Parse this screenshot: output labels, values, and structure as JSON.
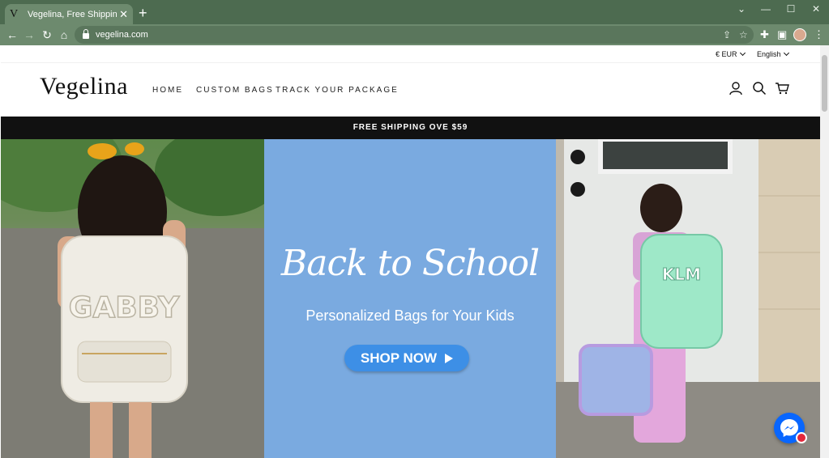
{
  "browser": {
    "tab_title": "Vegelina, Free Shipping ,Keep Mo",
    "tab_favicon_letter": "V",
    "url": "vegelina.com",
    "theme_colors": {
      "titlebar": "#4d6b50",
      "toolbar": "#6d8a6e"
    }
  },
  "site": {
    "currency": "€ EUR",
    "language": "English",
    "logo": "Vegelina",
    "nav": [
      "HOME",
      "CUSTOM BAGS",
      "TRACK YOUR PACKAGE"
    ],
    "announcement": "FREE SHIPPING OVE $59"
  },
  "hero": {
    "title": "Back to School",
    "subtitle": "Personalized Bags for Your Kids",
    "cta": "SHOP NOW",
    "left_bag_text": "GABBY",
    "right_bag_text": "KLM",
    "accent_blue": "#7aaae0",
    "button_blue": "#3d8fe6"
  },
  "icons": [
    "back-icon",
    "forward-icon",
    "reload-icon",
    "home-icon",
    "lock-icon",
    "share-icon",
    "star-icon",
    "extensions-icon",
    "sidepanel-icon",
    "menu-icon",
    "account-icon",
    "search-icon",
    "cart-icon",
    "messenger-icon"
  ]
}
